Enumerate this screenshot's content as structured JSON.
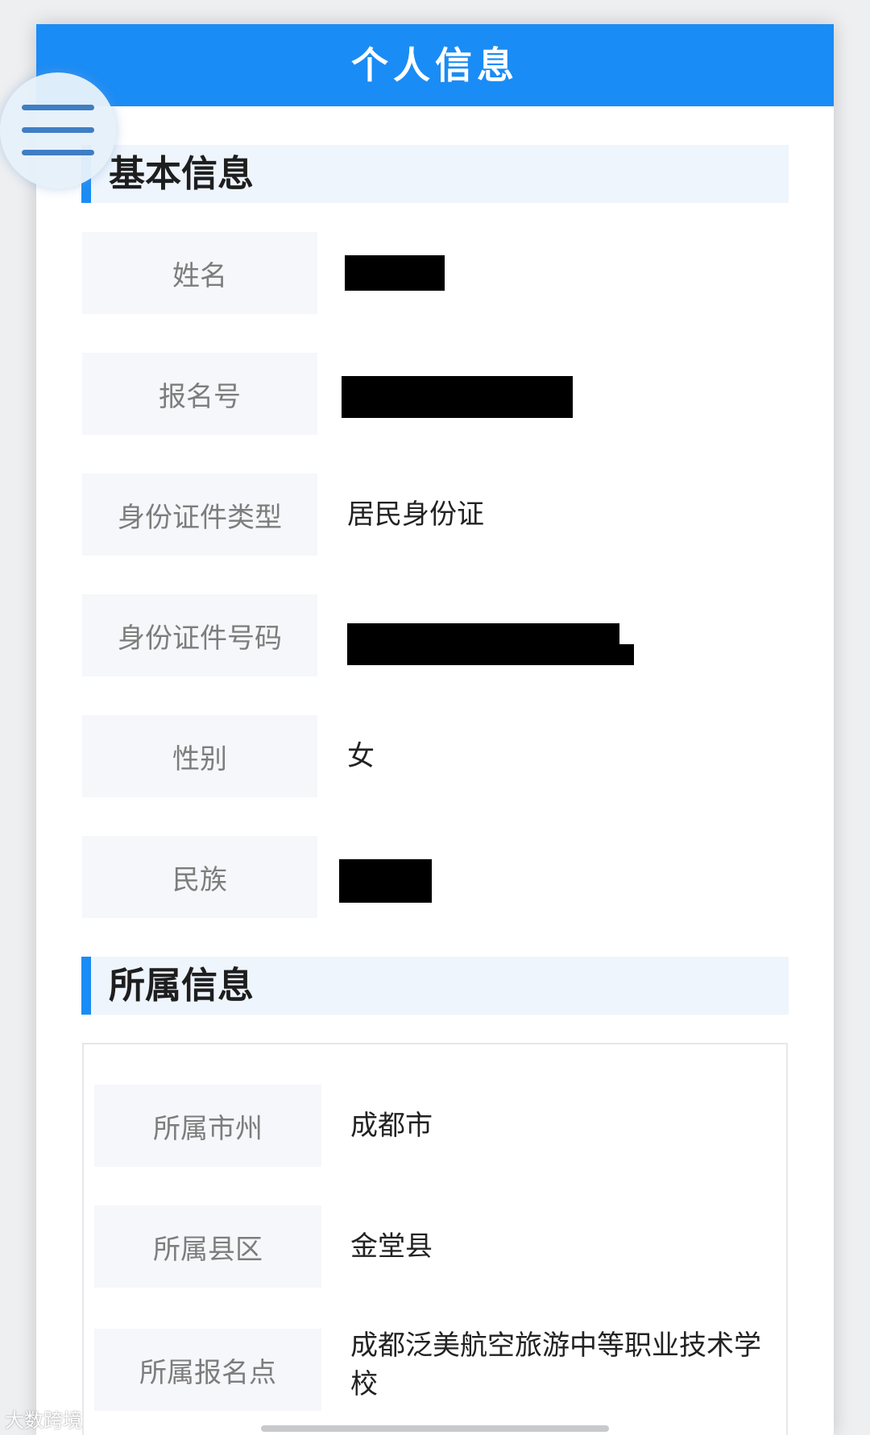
{
  "header": {
    "title": "个人信息"
  },
  "menu": {
    "icon": "hamburger-menu-icon"
  },
  "basic": {
    "title": "基本信息",
    "rows": [
      {
        "label": "姓名",
        "value": ""
      },
      {
        "label": "报名号",
        "value": ""
      },
      {
        "label": "身份证件类型",
        "value": "居民身份证"
      },
      {
        "label": "身份证件号码",
        "value": ""
      },
      {
        "label": "性别",
        "value": "女"
      },
      {
        "label": "民族",
        "value": ""
      }
    ]
  },
  "affiliation": {
    "title": "所属信息",
    "rows": [
      {
        "label": "所属市州",
        "value": "成都市"
      },
      {
        "label": "所属县区",
        "value": "金堂县"
      },
      {
        "label": "所属报名点",
        "value": "成都泛美航空旅游中等职业技术学校"
      }
    ]
  },
  "watermark": {
    "text": "大数跨境"
  },
  "colors": {
    "accent": "#1a8cf5",
    "section_bg": "#eef5fd",
    "label_bg": "#f5f7fa",
    "redaction": "#000000"
  }
}
